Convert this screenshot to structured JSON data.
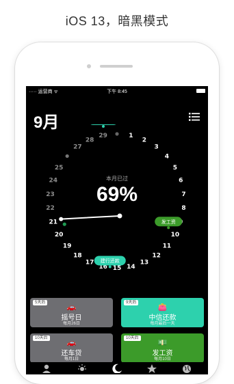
{
  "headline": "iOS 13，暗黑模式",
  "status": {
    "carrier": "····· 运营商 ᯤ",
    "time": "下午 8:45"
  },
  "month_title": "9月",
  "dial": {
    "center_label": "本月已过",
    "percent": "69%",
    "days": [
      "1",
      "2",
      "3",
      "4",
      "5",
      "6",
      "7",
      "8",
      "9",
      "10",
      "11",
      "12",
      "13",
      "14",
      "15",
      "16",
      "17",
      "18",
      "19",
      "20",
      "21",
      "22",
      "23",
      "24",
      "25",
      "26",
      "27",
      "28",
      "29",
      "30"
    ],
    "current_day": 21,
    "markers": [
      {
        "label": "中信还款",
        "color": "#2dd1ad"
      },
      {
        "label": "发工资",
        "color": "#3c9b2a"
      },
      {
        "label": "建行还款",
        "color": "#2dd1ad"
      }
    ]
  },
  "cards": [
    {
      "badge": "5天后",
      "title": "摇号日",
      "sub": "每月26日",
      "icon": "car-icon",
      "color": "#6e6e72"
    },
    {
      "badge": "9天后",
      "title": "中信还款",
      "sub": "每月最后一天",
      "icon": "wallet-icon",
      "color": "#2dd1ad"
    },
    {
      "badge": "10天后",
      "title": "还车贷",
      "sub": "每月1日",
      "icon": "car-icon",
      "color": "#6e6e72"
    },
    {
      "badge": "10天后",
      "title": "发工资",
      "sub": "每月10日",
      "icon": "money-icon",
      "color": "#3c9b2a"
    }
  ],
  "tabs": [
    "person-icon",
    "sun-icon",
    "moon-icon",
    "star-icon",
    "globe-icon"
  ]
}
